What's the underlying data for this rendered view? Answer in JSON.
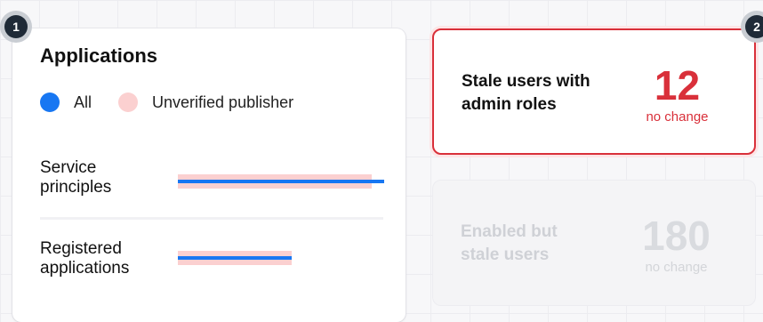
{
  "badges": [
    "1",
    "2"
  ],
  "applications": {
    "title": "Applications",
    "legend": [
      {
        "label": "All",
        "color": "#1877f2"
      },
      {
        "label": "Unverified publisher",
        "color": "#fbd0d0"
      }
    ],
    "rows": [
      {
        "label_line1": "Service",
        "label_line2": "principles",
        "all_fraction": 1.0,
        "unverified_fraction": 0.94
      },
      {
        "label_line1": "Registered",
        "label_line2": "applications",
        "all_fraction": 1.0,
        "unverified_fraction": 1.0
      }
    ]
  },
  "stats": [
    {
      "label_line1": "Stale users with",
      "label_line2": "admin roles",
      "value": "12",
      "change": "no change",
      "accent": "#d9303a"
    },
    {
      "label_line1": "Enabled but",
      "label_line2": "stale users",
      "value": "180",
      "change": "no change"
    }
  ]
}
